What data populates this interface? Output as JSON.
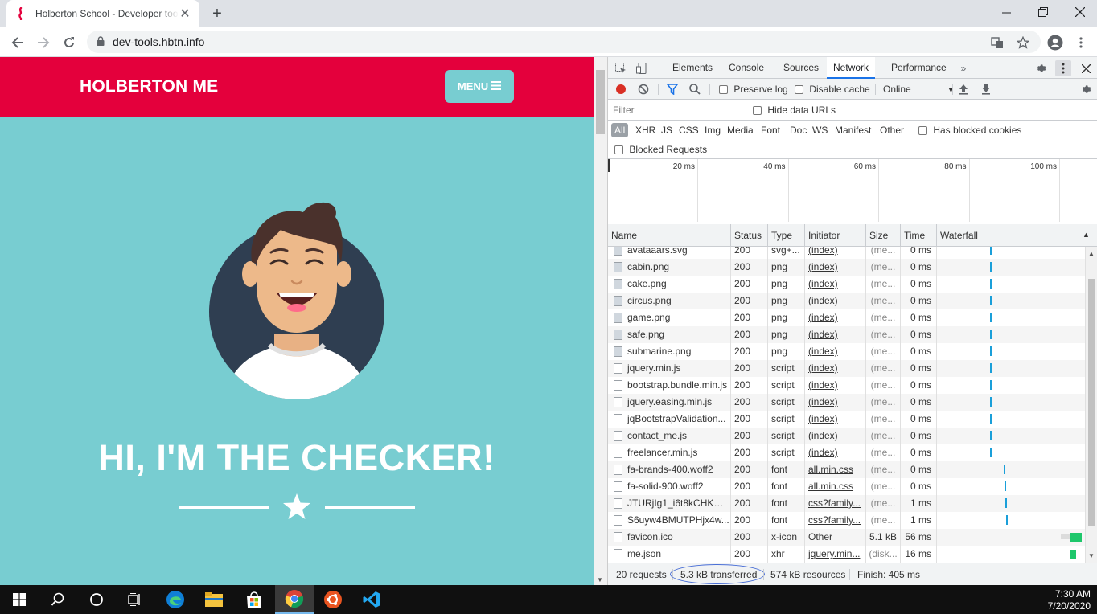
{
  "browser": {
    "tab_title": "Holberton School - Developer tools",
    "url": "dev-tools.hbtn.info"
  },
  "page": {
    "brand": "HOLBERTON ME",
    "menu_label": "MENU",
    "hero_title": "HI, I'M THE CHECKER!"
  },
  "devtools": {
    "tabs": [
      "Elements",
      "Console",
      "Sources",
      "Network",
      "Performance"
    ],
    "active_tab": "Network",
    "toolbar": {
      "preserve_log": "Preserve log",
      "disable_cache": "Disable cache",
      "throttling": "Online"
    },
    "filter_placeholder": "Filter",
    "hide_data_urls": "Hide data URLs",
    "filter_types": [
      "All",
      "XHR",
      "JS",
      "CSS",
      "Img",
      "Media",
      "Font",
      "Doc",
      "WS",
      "Manifest",
      "Other"
    ],
    "has_blocked_cookies": "Has blocked cookies",
    "blocked_requests": "Blocked Requests",
    "timeline_ticks": [
      "20 ms",
      "40 ms",
      "60 ms",
      "80 ms",
      "100 ms"
    ],
    "columns": [
      "Name",
      "Status",
      "Type",
      "Initiator",
      "Size",
      "Time",
      "Waterfall"
    ],
    "requests": [
      {
        "name": "avataaars.svg",
        "status": "200",
        "type": "svg+...",
        "initiator": "(index)",
        "size": "(me...",
        "time": "0 ms",
        "icon": "image-file-icon"
      },
      {
        "name": "cabin.png",
        "status": "200",
        "type": "png",
        "initiator": "(index)",
        "size": "(me...",
        "time": "0 ms",
        "icon": "image-file-icon"
      },
      {
        "name": "cake.png",
        "status": "200",
        "type": "png",
        "initiator": "(index)",
        "size": "(me...",
        "time": "0 ms",
        "icon": "image-file-icon"
      },
      {
        "name": "circus.png",
        "status": "200",
        "type": "png",
        "initiator": "(index)",
        "size": "(me...",
        "time": "0 ms",
        "icon": "image-file-icon"
      },
      {
        "name": "game.png",
        "status": "200",
        "type": "png",
        "initiator": "(index)",
        "size": "(me...",
        "time": "0 ms",
        "icon": "image-file-icon"
      },
      {
        "name": "safe.png",
        "status": "200",
        "type": "png",
        "initiator": "(index)",
        "size": "(me...",
        "time": "0 ms",
        "icon": "image-file-icon"
      },
      {
        "name": "submarine.png",
        "status": "200",
        "type": "png",
        "initiator": "(index)",
        "size": "(me...",
        "time": "0 ms",
        "icon": "image-file-icon"
      },
      {
        "name": "jquery.min.js",
        "status": "200",
        "type": "script",
        "initiator": "(index)",
        "size": "(me...",
        "time": "0 ms",
        "icon": "script-file-icon"
      },
      {
        "name": "bootstrap.bundle.min.js",
        "status": "200",
        "type": "script",
        "initiator": "(index)",
        "size": "(me...",
        "time": "0 ms",
        "icon": "script-file-icon"
      },
      {
        "name": "jquery.easing.min.js",
        "status": "200",
        "type": "script",
        "initiator": "(index)",
        "size": "(me...",
        "time": "0 ms",
        "icon": "script-file-icon"
      },
      {
        "name": "jqBootstrapValidation...",
        "status": "200",
        "type": "script",
        "initiator": "(index)",
        "size": "(me...",
        "time": "0 ms",
        "icon": "script-file-icon"
      },
      {
        "name": "contact_me.js",
        "status": "200",
        "type": "script",
        "initiator": "(index)",
        "size": "(me...",
        "time": "0 ms",
        "icon": "script-file-icon"
      },
      {
        "name": "freelancer.min.js",
        "status": "200",
        "type": "script",
        "initiator": "(index)",
        "size": "(me...",
        "time": "0 ms",
        "icon": "script-file-icon"
      },
      {
        "name": "fa-brands-400.woff2",
        "status": "200",
        "type": "font",
        "initiator": "all.min.css",
        "size": "(me...",
        "time": "0 ms",
        "icon": "font-file-icon"
      },
      {
        "name": "fa-solid-900.woff2",
        "status": "200",
        "type": "font",
        "initiator": "all.min.css",
        "size": "(me...",
        "time": "0 ms",
        "icon": "font-file-icon"
      },
      {
        "name": "JTURjIg1_i6t8kCHKm4...",
        "status": "200",
        "type": "font",
        "initiator": "css?family...",
        "size": "(me...",
        "time": "1 ms",
        "icon": "font-file-icon"
      },
      {
        "name": "S6uyw4BMUTPHjx4w...",
        "status": "200",
        "type": "font",
        "initiator": "css?family...",
        "size": "(me...",
        "time": "1 ms",
        "icon": "font-file-icon"
      },
      {
        "name": "favicon.ico",
        "status": "200",
        "type": "x-icon",
        "initiator": "Other",
        "size": "5.1 kB",
        "time": "56 ms",
        "icon": "file-icon"
      },
      {
        "name": "me.json",
        "status": "200",
        "type": "xhr",
        "initiator": "jquery.min...",
        "size": "(disk...",
        "time": "16 ms",
        "icon": "file-icon"
      }
    ],
    "summary": {
      "requests": "20 requests",
      "transferred": "5.3 kB transferred",
      "resources": "574 kB resources",
      "finish": "Finish: 405 ms"
    }
  },
  "taskbar": {
    "time": "7:30 AM",
    "date": "7/20/2020"
  },
  "colors": {
    "navbar": "#e4003c",
    "page_bg": "#78cdd1",
    "devtools_accent": "#1a73e8"
  }
}
